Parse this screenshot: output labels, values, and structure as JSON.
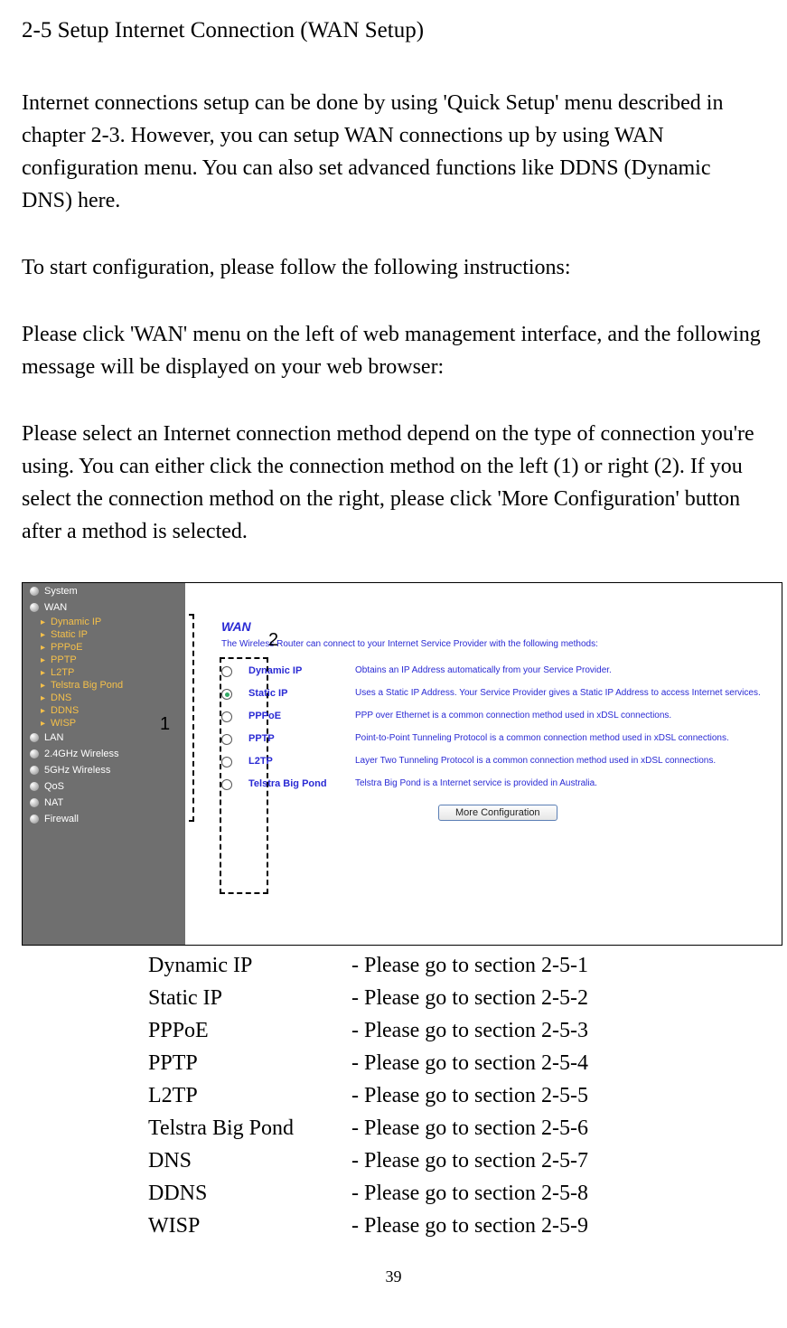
{
  "heading": "2-5 Setup Internet Connection (WAN Setup)",
  "para1": "Internet connections setup can be done by using 'Quick Setup' menu described in chapter 2-3. However, you can setup WAN connections up by using WAN configuration menu. You can also set advanced functions like DDNS (Dynamic DNS) here.",
  "para2": "To start configuration, please follow the following instructions:",
  "para3": "Please click 'WAN' menu on the left of web management interface, and the following message will be displayed on your web browser:",
  "para4": "Please select an Internet connection method depend on the type of connection you're using. You can either click the connection method on the left (1) or right (2). If you select the connection method on the right, please click 'More Configuration' button after a method is selected.",
  "callouts": {
    "one": "1",
    "two": "2"
  },
  "sidebar": {
    "main": [
      "System",
      "WAN",
      "LAN",
      "2.4GHz Wireless",
      "5GHz Wireless",
      "QoS",
      "NAT",
      "Firewall"
    ],
    "wan_sub": [
      "Dynamic IP",
      "Static IP",
      "PPPoE",
      "PPTP",
      "L2TP",
      "Telstra Big Pond",
      "DNS",
      "DDNS",
      "WISP"
    ]
  },
  "wan_panel": {
    "title": "WAN",
    "subtitle": "The Wireless Router can connect to your Internet Service Provider with the following methods:",
    "options": [
      {
        "name": "Dynamic IP",
        "checked": false,
        "desc": "Obtains an IP Address automatically from your Service Provider."
      },
      {
        "name": "Static IP",
        "checked": true,
        "desc": "Uses a Static IP Address. Your Service Provider gives a Static IP Address to access Internet services."
      },
      {
        "name": "PPPoE",
        "checked": false,
        "desc": "PPP over Ethernet is a common connection method used in xDSL connections."
      },
      {
        "name": "PPTP",
        "checked": false,
        "desc": "Point-to-Point Tunneling Protocol is a common connection method used in xDSL connections."
      },
      {
        "name": "L2TP",
        "checked": false,
        "desc": "Layer Two Tunneling Protocol is a common connection method used in xDSL connections."
      },
      {
        "name": "Telstra Big Pond",
        "checked": false,
        "desc": "Telstra Big Pond is a Internet service is provided in Australia."
      }
    ],
    "button": "More Configuration"
  },
  "refs": [
    {
      "name": "Dynamic IP",
      "target": "- Please go to section 2-5-1"
    },
    {
      "name": "Static IP",
      "target": "- Please go to section 2-5-2"
    },
    {
      "name": "PPPoE",
      "target": "- Please go to section 2-5-3"
    },
    {
      "name": "PPTP",
      "target": "- Please go to section 2-5-4"
    },
    {
      "name": "L2TP",
      "target": "- Please go to section 2-5-5"
    },
    {
      "name": "Telstra Big Pond",
      "target": "- Please go to section 2-5-6"
    },
    {
      "name": "DNS",
      "target": "- Please go to section 2-5-7"
    },
    {
      "name": "DDNS",
      "target": "- Please go to section 2-5-8"
    },
    {
      "name": "WISP",
      "target": "- Please go to section 2-5-9"
    }
  ],
  "page_number": "39"
}
